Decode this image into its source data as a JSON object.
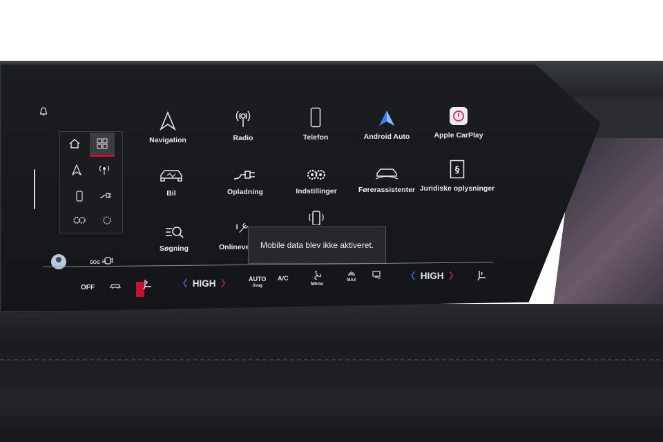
{
  "home_panel": {
    "tabs": [
      "home-icon",
      "apps-grid-icon"
    ]
  },
  "apps": [
    {
      "label": "Navigation",
      "icon": "navigation-arrow-icon"
    },
    {
      "label": "Radio",
      "icon": "radio-antenna-icon"
    },
    {
      "label": "Telefon",
      "icon": "phone-icon"
    },
    {
      "label": "Android Auto",
      "icon": "android-auto-icon"
    },
    {
      "label": "Apple CarPlay",
      "icon": "apple-carplay-icon"
    },
    {
      "label": "Bil",
      "icon": "car-icon"
    },
    {
      "label": "Opladning",
      "icon": "charging-plug-icon"
    },
    {
      "label": "Indstillinger",
      "icon": "settings-gears-icon"
    },
    {
      "label": "Førerassistenter",
      "icon": "driver-assist-icon"
    },
    {
      "label": "Juridiske oplysninger",
      "icon": "legal-section-icon"
    },
    {
      "label": "Søgning",
      "icon": "search-icon"
    },
    {
      "label": "Onlinevej",
      "icon": "online-services-icon"
    }
  ],
  "toast": {
    "message": "Mobile data blev ikke aktiveret."
  },
  "status": {
    "sos_label": "SOS"
  },
  "climate": {
    "off_label": "OFF",
    "left_level": "HIGH",
    "auto_label": "AUTO",
    "auto_sub": "Svag",
    "ac_label": "A/C",
    "menu_label": "Menu",
    "max_label": "MAX",
    "right_level": "HIGH"
  },
  "colors": {
    "accent_red": "#c8102e",
    "chevron_blue": "#2f7de1",
    "android_blue": "#3b82f6"
  }
}
